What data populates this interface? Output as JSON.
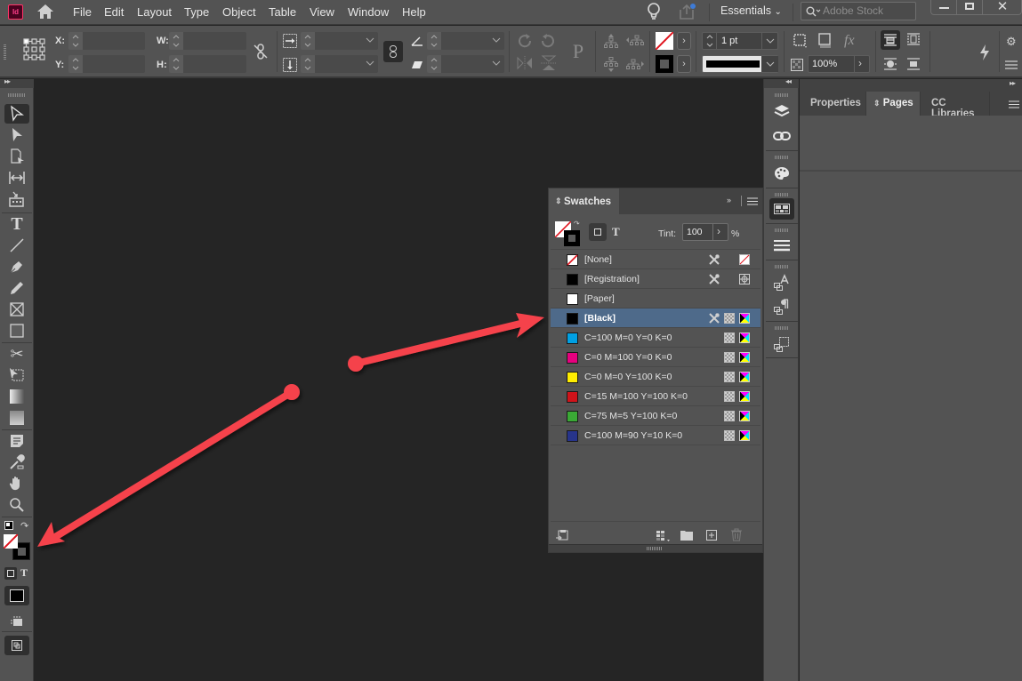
{
  "app": {
    "logo_text": "Id"
  },
  "menu": [
    "File",
    "Edit",
    "Layout",
    "Type",
    "Object",
    "Table",
    "View",
    "Window",
    "Help"
  ],
  "header": {
    "workspace": "Essentials",
    "stock_placeholder": "Adobe Stock"
  },
  "control_bar": {
    "x_label": "X:",
    "y_label": "Y:",
    "w_label": "W:",
    "h_label": "H:",
    "x_value": "",
    "y_value": "",
    "w_value": "",
    "h_value": "",
    "stroke_weight": "1 pt",
    "opacity": "100%"
  },
  "swatches_panel": {
    "title": "Swatches",
    "tint_label": "Tint:",
    "tint_value": "100",
    "tint_unit": "%",
    "text_toggle": "T",
    "items": [
      {
        "name": "[None]",
        "color": "none",
        "selected": false,
        "locked": true,
        "type": "none"
      },
      {
        "name": "[Registration]",
        "color": "#000000",
        "selected": false,
        "locked": true,
        "type": "registration"
      },
      {
        "name": "[Paper]",
        "color": "#ffffff",
        "selected": false,
        "locked": false,
        "type": "paper"
      },
      {
        "name": "[Black]",
        "color": "#000000",
        "selected": true,
        "locked": true,
        "type": "cmyk"
      },
      {
        "name": "C=100 M=0 Y=0 K=0",
        "color": "#00a0e3",
        "selected": false,
        "locked": false,
        "type": "cmyk"
      },
      {
        "name": "C=0 M=100 Y=0 K=0",
        "color": "#e6007e",
        "selected": false,
        "locked": false,
        "type": "cmyk"
      },
      {
        "name": "C=0 M=0 Y=100 K=0",
        "color": "#ffed00",
        "selected": false,
        "locked": false,
        "type": "cmyk"
      },
      {
        "name": "C=15 M=100 Y=100 K=0",
        "color": "#d0131a",
        "selected": false,
        "locked": false,
        "type": "cmyk"
      },
      {
        "name": "C=75 M=5 Y=100 K=0",
        "color": "#3aa935",
        "selected": false,
        "locked": false,
        "type": "cmyk"
      },
      {
        "name": "C=100 M=90 Y=10 K=0",
        "color": "#27348b",
        "selected": false,
        "locked": false,
        "type": "cmyk"
      }
    ]
  },
  "right_panel": {
    "tabs": [
      {
        "label": "Properties",
        "active": false
      },
      {
        "label": "Pages",
        "active": true
      },
      {
        "label": "CC Libraries",
        "active": false
      }
    ]
  },
  "toolbox": {
    "text_toggle": "T"
  },
  "annotations": {
    "arrow_color": "#f5424b"
  }
}
